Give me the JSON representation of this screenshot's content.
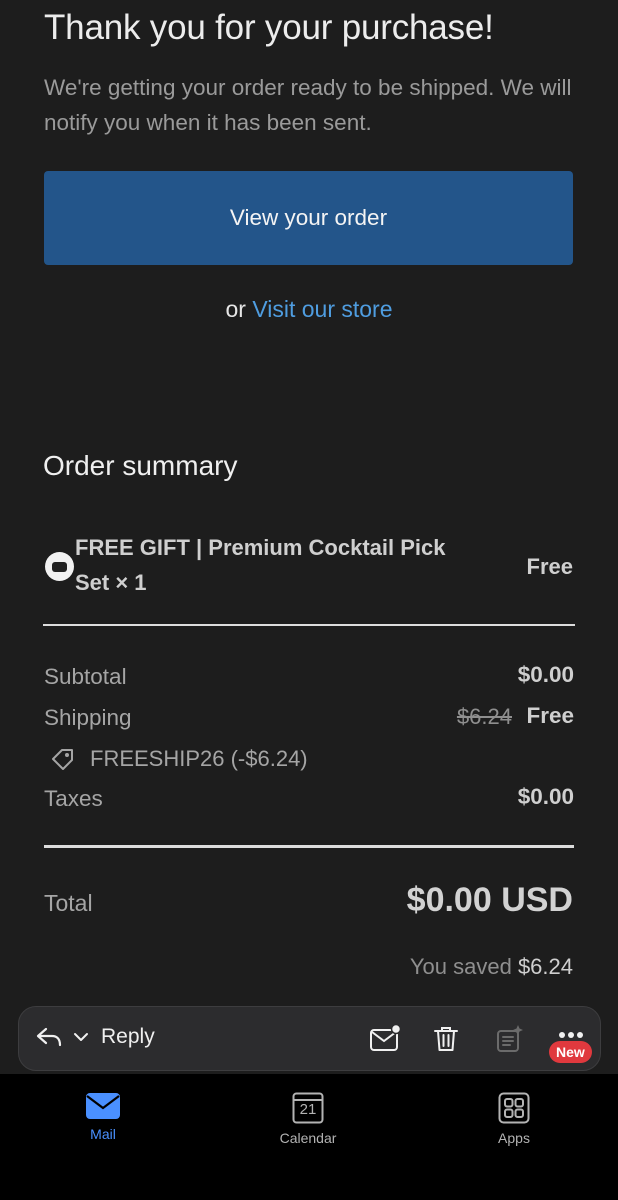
{
  "email": {
    "title": "Thank you for your purchase!",
    "subtitle": "We're getting your order ready to be shipped. We will notify you when it has been sent.",
    "primary_button": "View your order",
    "alt_prefix": "or",
    "alt_link": "Visit our store"
  },
  "order_summary": {
    "heading": "Order summary",
    "item": {
      "name": "FREE GIFT | Premium Cocktail Pick Set × 1",
      "price": "Free"
    },
    "subtotal_label": "Subtotal",
    "subtotal_value": "$0.00",
    "shipping_label": "Shipping",
    "shipping_original": "$6.24",
    "shipping_value": "Free",
    "discount": "FREESHIP26 (-$6.24)",
    "taxes_label": "Taxes",
    "taxes_value": "$0.00",
    "total_label": "Total",
    "total_value": "$0.00 USD",
    "saved_prefix": "You saved",
    "saved_amount": "$6.24"
  },
  "toolbar": {
    "reply_label": "Reply",
    "new_badge": "New"
  },
  "tabbar": {
    "tabs": [
      {
        "label": "Mail",
        "icon": "mail-icon",
        "active": true
      },
      {
        "label": "Calendar",
        "icon": "calendar-icon",
        "day": "21"
      },
      {
        "label": "Apps",
        "icon": "apps-icon"
      }
    ]
  },
  "colors": {
    "background": "#1d1d1d",
    "primary_button": "#23558a",
    "link": "#4f9de0",
    "active_tab": "#4a90ff",
    "badge": "#e0393e"
  }
}
